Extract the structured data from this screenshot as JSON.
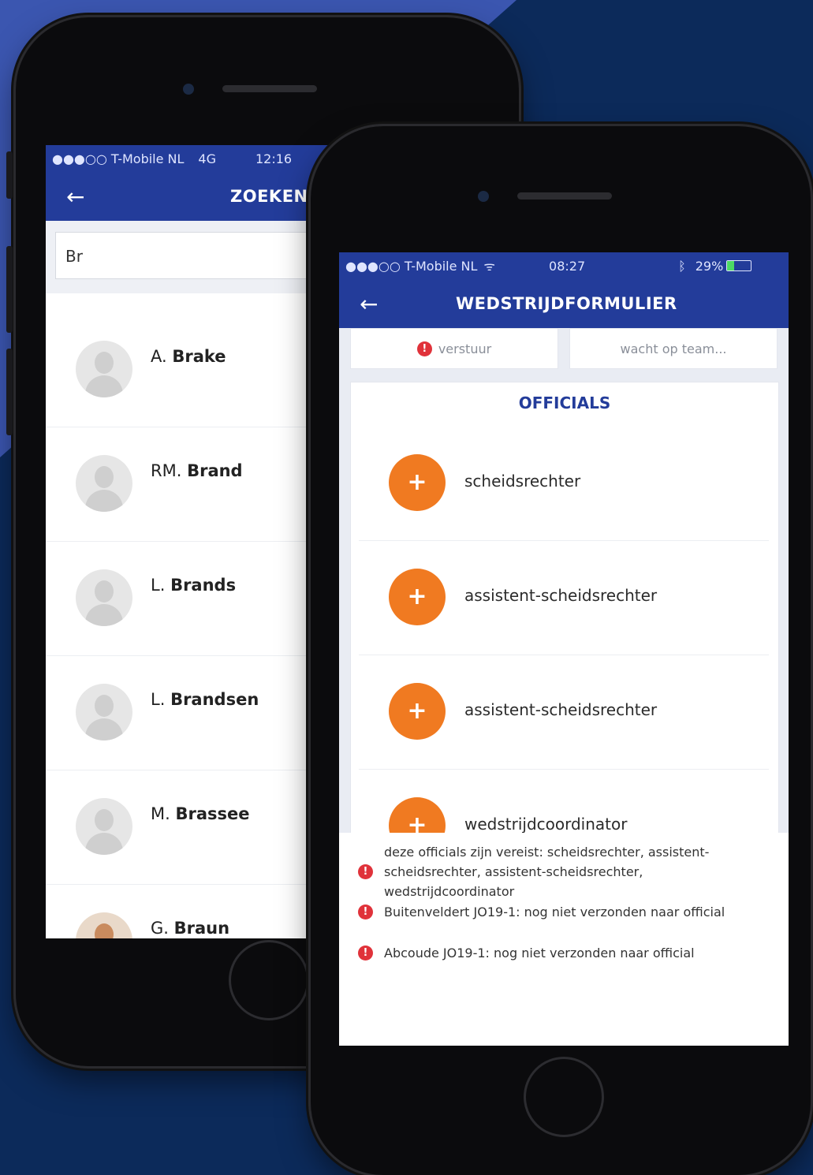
{
  "phone_search": {
    "status": {
      "carrier": "●●●○○ T-Mobile NL",
      "network": "4G",
      "time": "12:16"
    },
    "nav": {
      "title": "ZOEKEN"
    },
    "search": {
      "value": "Br"
    },
    "results": [
      {
        "initial": "A.",
        "surname": "Brake"
      },
      {
        "initial": "RM.",
        "surname": "Brand"
      },
      {
        "initial": "L.",
        "surname": "Brands"
      },
      {
        "initial": "L.",
        "surname": "Brandsen"
      },
      {
        "initial": "M.",
        "surname": "Brassee"
      },
      {
        "initial": "G.",
        "surname": "Braun"
      }
    ]
  },
  "phone_form": {
    "status": {
      "carrier": "●●●○○ T-Mobile NL",
      "time": "08:27",
      "battery": "29%"
    },
    "nav": {
      "title": "WEDSTRIJDFORMULIER"
    },
    "top_cards": {
      "left_label": "verstuur",
      "right_label": "wacht op team..."
    },
    "officials": {
      "title": "OFFICIALS",
      "items": [
        "scheidsrechter",
        "assistent-scheidsrechter",
        "assistent-scheidsrechter",
        "wedstrijdcoordinator"
      ]
    },
    "warnings": [
      "deze officials zijn vereist: scheidsrechter, assistent-scheidsrechter, assistent-scheidsrechter, wedstrijdcoordinator",
      "Buitenveldert JO19-1: nog niet verzonden naar official",
      "Abcoude JO19-1: nog niet verzonden naar official"
    ],
    "error_glyph": "!"
  },
  "icons": {
    "back": "←",
    "plus": "+"
  },
  "colors": {
    "brand_blue": "#233c9a",
    "accent_orange": "#f07a21",
    "error_red": "#e0323a",
    "background": "#0c2a5a"
  }
}
